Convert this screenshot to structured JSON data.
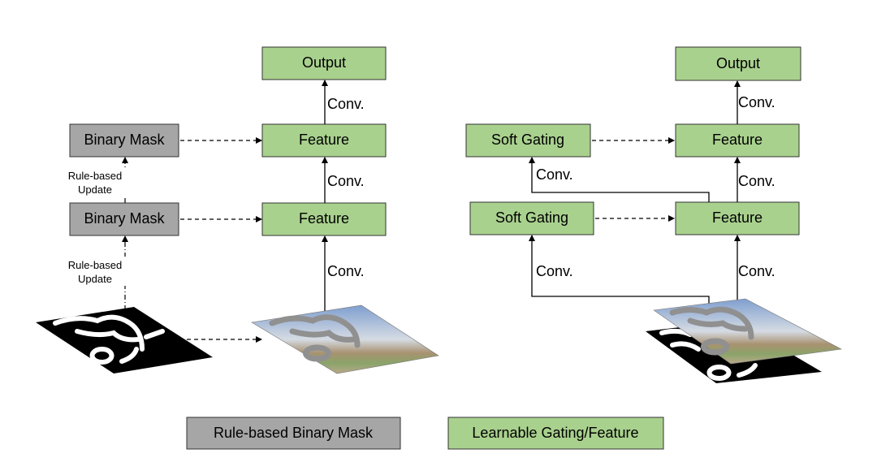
{
  "left": {
    "output_label": "Output",
    "feature_top_label": "Feature",
    "feature_mid_label": "Feature",
    "mask_top_label": "Binary Mask",
    "mask_mid_label": "Binary Mask",
    "conv_labels": [
      "Conv.",
      "Conv.",
      "Conv."
    ],
    "update_labels": [
      {
        "line1": "Rule-based",
        "line2": "Update"
      },
      {
        "line1": "Rule-based",
        "line2": "Update"
      }
    ]
  },
  "right": {
    "output_label": "Output",
    "feature_top_label": "Feature",
    "feature_mid_label": "Feature",
    "gating_top_label": "Soft Gating",
    "gating_mid_label": "Soft Gating",
    "conv_labels": [
      "Conv.",
      "Conv.",
      "Conv.",
      "Conv.",
      "Conv."
    ]
  },
  "legend": {
    "rule_based": "Rule-based Binary Mask",
    "learnable": "Learnable Gating/Feature"
  },
  "colors": {
    "learnable": "#a9d18e",
    "rule_based": "#a6a6a6"
  }
}
